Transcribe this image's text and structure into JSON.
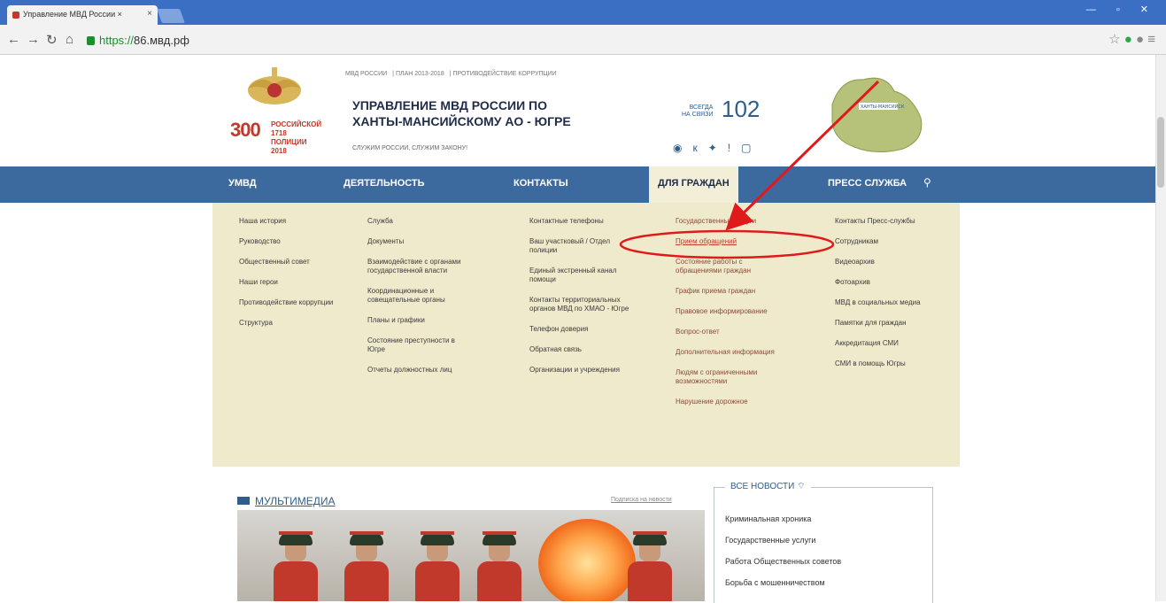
{
  "browser": {
    "tab_title": "Управление МВД России × ",
    "url_scheme": "https://",
    "url_host": "86.мвд.рф"
  },
  "header": {
    "topnav": [
      "МВД РОССИИ",
      "ПЛАН 2013-2018",
      "ПРОТИВОДЕЙСТВИЕ КОРРУПЦИИ"
    ],
    "org_title_line1": "УПРАВЛЕНИЕ МВД РОССИИ ПО",
    "org_title_line2": "ХАНТЫ-МАНСИЙСКОМУ АО - ЮГРЕ",
    "motto": "СЛУЖИМ РОССИИ, СЛУЖИМ ЗАКОНУ!",
    "anniversary_number": "300",
    "anniversary_text": "РОССИЙСКОЙ 1718 ПОЛИЦИИ 2018",
    "always_line1": "ВСЕГДА",
    "always_line2": "НА СВЯЗИ",
    "hotline": "102",
    "social_icons": [
      "eye-icon",
      "vk-icon",
      "twitter-icon",
      "ok-icon",
      "instagram-icon"
    ],
    "map_label": "ХАНТЫ-МАНСИЙСК"
  },
  "nav": {
    "items": [
      "УМВД",
      "ДЕЯТЕЛЬНОСТЬ",
      "КОНТАКТЫ",
      "ДЛЯ ГРАЖДАН",
      "ПРЕСС СЛУЖБА"
    ],
    "active_index": 3
  },
  "dropdown": {
    "col1": [
      "Наша история",
      "Руководство",
      "Общественный совет",
      "Наши герои",
      "Противодействие коррупции",
      "Структура"
    ],
    "col2": [
      "Служба",
      "Документы",
      "Взаимодействие с органами государственной власти",
      "Координационные и совещательные органы",
      "Планы и графики",
      "Состояние преступности в Югре",
      "Отчеты должностных лиц"
    ],
    "col3": [
      "Контактные телефоны",
      "Ваш участковый / Отдел полиции",
      "Единый экстренный канал помощи",
      "Контакты территориальных органов МВД по ХМАО - Югре",
      "Телефон доверия",
      "Обратная связь",
      "Организации и учреждения"
    ],
    "col4": [
      "Государственные услуги",
      "Прием обращений",
      "Состояние работы с обращениями граждан",
      "График приема граждан",
      "Правовое информирование",
      "Вопрос-ответ",
      "Дополнительная информация",
      "Людям с ограниченными возможностями",
      "Нарушение дорожное"
    ],
    "col5": [
      "Контакты Пресс-службы",
      "Сотрудникам",
      "Видеоархив",
      "Фотоархив",
      "МВД в социальных медиа",
      "Памятки для граждан",
      "Аккредитация СМИ",
      "СМИ в помощь Югры"
    ],
    "highlight_item": "Прием обращений"
  },
  "multimedia": {
    "title": "МУЛЬТИМЕДИА",
    "subscribe": "Подписка на новости"
  },
  "news": {
    "title": "ВСЕ НОВОСТИ",
    "items": [
      "Криминальная хроника",
      "Государственные услуги",
      "Работа Общественных советов",
      "Борьба с мошенничеством"
    ]
  },
  "annotation": {
    "color": "#e01a1a"
  }
}
